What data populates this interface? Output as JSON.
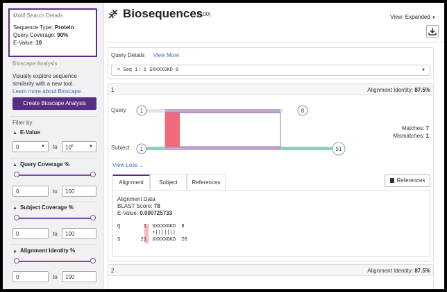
{
  "sidebar": {
    "motif_box": {
      "title": "Motif Search Details",
      "sequence_type_label": "Sequence Type:",
      "sequence_type_value": "Protein",
      "query_coverage_label": "Query Coverage:",
      "query_coverage_value": "90%",
      "evalue_label": "E-Value:",
      "evalue_value": "10"
    },
    "bioscape": {
      "title": "Bioscape Analysis",
      "description": "Visually explore sequence similarity with a new tool.",
      "link": "Learn more about Bioscape.",
      "button": "Create Bioscape Analysis"
    },
    "filter_by": "Filter by",
    "filters": {
      "evalue": {
        "label": "E-Value",
        "min": "0",
        "to": "to",
        "max_base": "10",
        "max_exp": "6"
      },
      "query_coverage": {
        "label": "Query Coverage %",
        "min": "0",
        "to": "to",
        "max": "100",
        "range_min": 0,
        "range_max": 1
      },
      "subject_coverage": {
        "label": "Subject Coverage %",
        "min": "0",
        "to": "to",
        "max": "100",
        "range_min": 0,
        "range_max": 1
      },
      "alignment_identity": {
        "label": "Alignment Identity %",
        "min": "0",
        "to": "to",
        "max": "100",
        "range_min": 0,
        "range_max": 1
      }
    }
  },
  "header": {
    "title": "Biosequences",
    "count": "(100)",
    "view_label": "View:",
    "view_value": "Expanded",
    "icons": {
      "title": "dna-icon",
      "download": "download-icon"
    }
  },
  "query_details": {
    "label": "Query Details",
    "view_more": "View More",
    "sequence": "Seq 1: 1 SXXXXGKD 8"
  },
  "hits": [
    {
      "index": "1",
      "identity_label": "Alignment Identity:",
      "identity_value": "87.5%",
      "query_label": "Query",
      "subject_label": "Subject",
      "query_start": "1",
      "query_end": "8",
      "subject_start": "1",
      "subject_end": "51",
      "matches_label": "Matches:",
      "matches_value": "7",
      "mismatches_label": "Mismatches:",
      "mismatches_value": "1",
      "view_less": "View Less",
      "tabs": [
        "Alignment",
        "Subject",
        "References"
      ],
      "active_tab": "Alignment",
      "references_button": "References",
      "alignment_data": {
        "title": "Alignment Data",
        "blast_label": "BLAST Score:",
        "blast_value": "78",
        "evalue_label": "E-Value:",
        "evalue_value": "0.000725733",
        "q_line": "Q        1  SXXXXGKD  8",
        "mid_line": "            +|||||||",
        "s_line": "S       21  XXXXXGKD  28"
      }
    },
    {
      "index": "2",
      "identity_label": "Alignment Identity:",
      "identity_value": "87.5%"
    }
  ],
  "colors": {
    "accent": "#5a2d82",
    "slider": "#7b4ba8",
    "link": "#3b6fb6",
    "query_bar": "#c2a9cc",
    "subject_bar": "#8fcfbf",
    "mismatch": "#f06a7a"
  }
}
